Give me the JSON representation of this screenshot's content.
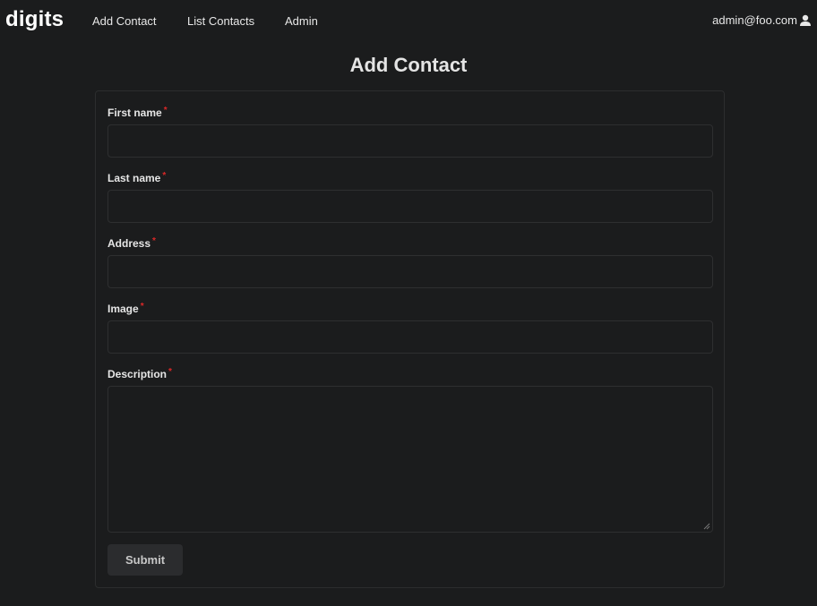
{
  "brand": "digits",
  "nav": {
    "items": [
      {
        "label": "Add Contact"
      },
      {
        "label": "List Contacts"
      },
      {
        "label": "Admin"
      }
    ],
    "user": "admin@foo.com",
    "user_icon": "user-icon"
  },
  "page": {
    "title": "Add Contact"
  },
  "form": {
    "required_marker": "*",
    "fields": [
      {
        "label": "First name",
        "value": ""
      },
      {
        "label": "Last name",
        "value": ""
      },
      {
        "label": "Address",
        "value": ""
      },
      {
        "label": "Image",
        "value": ""
      },
      {
        "label": "Description",
        "value": ""
      }
    ],
    "submit_label": "Submit"
  },
  "colors": {
    "background": "#1b1c1d",
    "required": "#db2828",
    "button": "#2b2c2e"
  }
}
